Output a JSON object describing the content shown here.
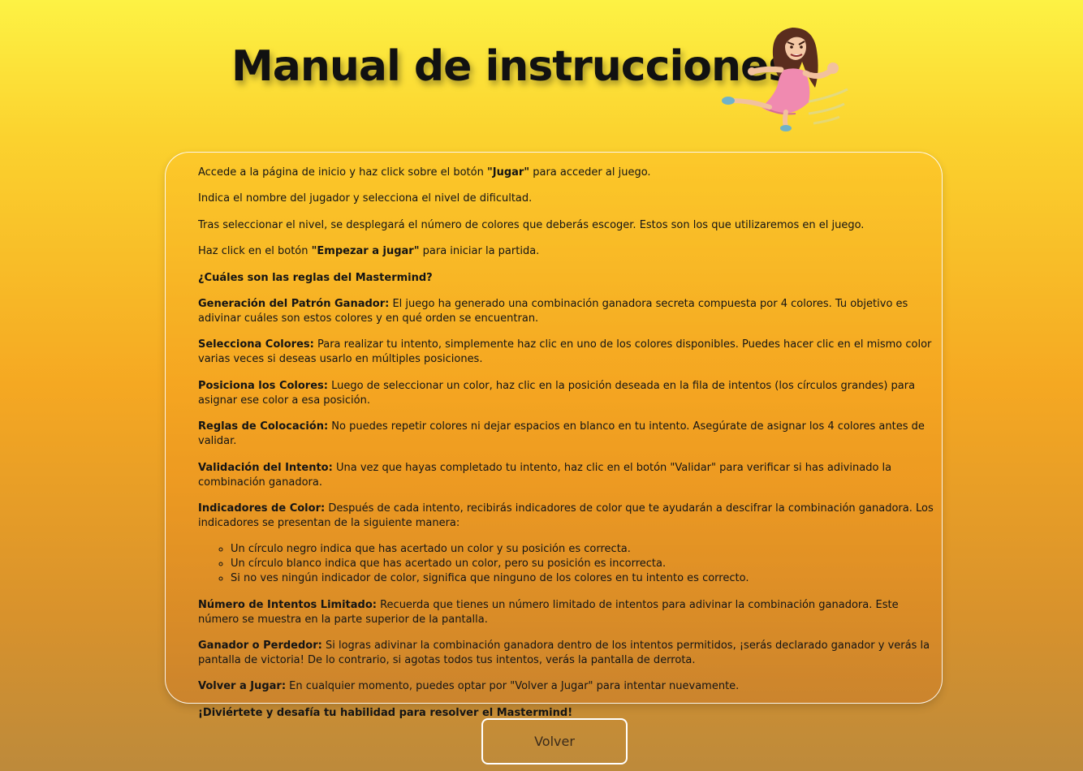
{
  "header": {
    "title": "Manual de instrucciones"
  },
  "steps": [
    {
      "pre": "Accede a la página de inicio y haz click sobre el botón ",
      "bold": "\"Jugar\"",
      "post": " para acceder al juego."
    },
    {
      "text": "Indica el nombre del jugador y selecciona el nivel de dificultad."
    },
    {
      "text": "Tras seleccionar el nivel, se desplegará el número de colores que deberás escoger. Estos son los que utilizaremos en el juego."
    },
    {
      "pre": "Haz click en el botón ",
      "bold": "\"Empezar a jugar\"",
      "post": " para iniciar la partida."
    }
  ],
  "rules_heading": "¿Cuáles son las reglas del Mastermind?",
  "rules": [
    {
      "term": "Generación del Patrón Ganador:",
      "text": " El juego ha generado una combinación ganadora secreta compuesta por 4 colores. Tu objetivo es adivinar cuáles son estos colores y en qué orden se encuentran."
    },
    {
      "term": "Selecciona Colores:",
      "text": " Para realizar tu intento, simplemente haz clic en uno de los colores disponibles. Puedes hacer clic en el mismo color varias veces si deseas usarlo en múltiples posiciones."
    },
    {
      "term": "Posiciona los Colores:",
      "text": " Luego de seleccionar un color, haz clic en la posición deseada en la fila de intentos (los círculos grandes) para asignar ese color a esa posición."
    },
    {
      "term": "Reglas de Colocación:",
      "text": " No puedes repetir colores ni dejar espacios en blanco en tu intento. Asegúrate de asignar los 4 colores antes de validar."
    },
    {
      "term": "Validación del Intento:",
      "text": " Una vez que hayas completado tu intento, haz clic en el botón \"Validar\" para verificar si has adivinado la combinación ganadora."
    },
    {
      "term": "Indicadores de Color:",
      "text": " Después de cada intento, recibirás indicadores de color que te ayudarán a descifrar la combinación ganadora. Los indicadores se presentan de la siguiente manera:"
    },
    {
      "term": "Número de Intentos Limitado:",
      "text": " Recuerda que tienes un número limitado de intentos para adivinar la combinación ganadora. Este número se muestra en la parte superior de la pantalla."
    },
    {
      "term": "Ganador o Perdedor:",
      "text": " Si logras adivinar la combinación ganadora dentro de los intentos permitidos, ¡serás declarado ganador y verás la pantalla de victoria! De lo contrario, si agotas todos tus intentos, verás la pantalla de derrota."
    },
    {
      "term": "Volver a Jugar:",
      "text": " En cualquier momento, puedes optar por \"Volver a Jugar\" para intentar nuevamente."
    }
  ],
  "indicators": [
    "Un círculo negro indica que has acertado un color y su posición es correcta.",
    "Un círculo blanco indica que has acertado un color, pero su posición es incorrecta.",
    "Si no ves ningún indicador de color, significa que ninguno de los colores en tu intento es correcto."
  ],
  "closing": "¡Diviértete y desafía tu habilidad para resolver el Mastermind!",
  "back_button_label": "Volver",
  "colors": {
    "background_top": "#fdf244",
    "background_bottom": "#bd8a3b",
    "text": "#141414"
  }
}
